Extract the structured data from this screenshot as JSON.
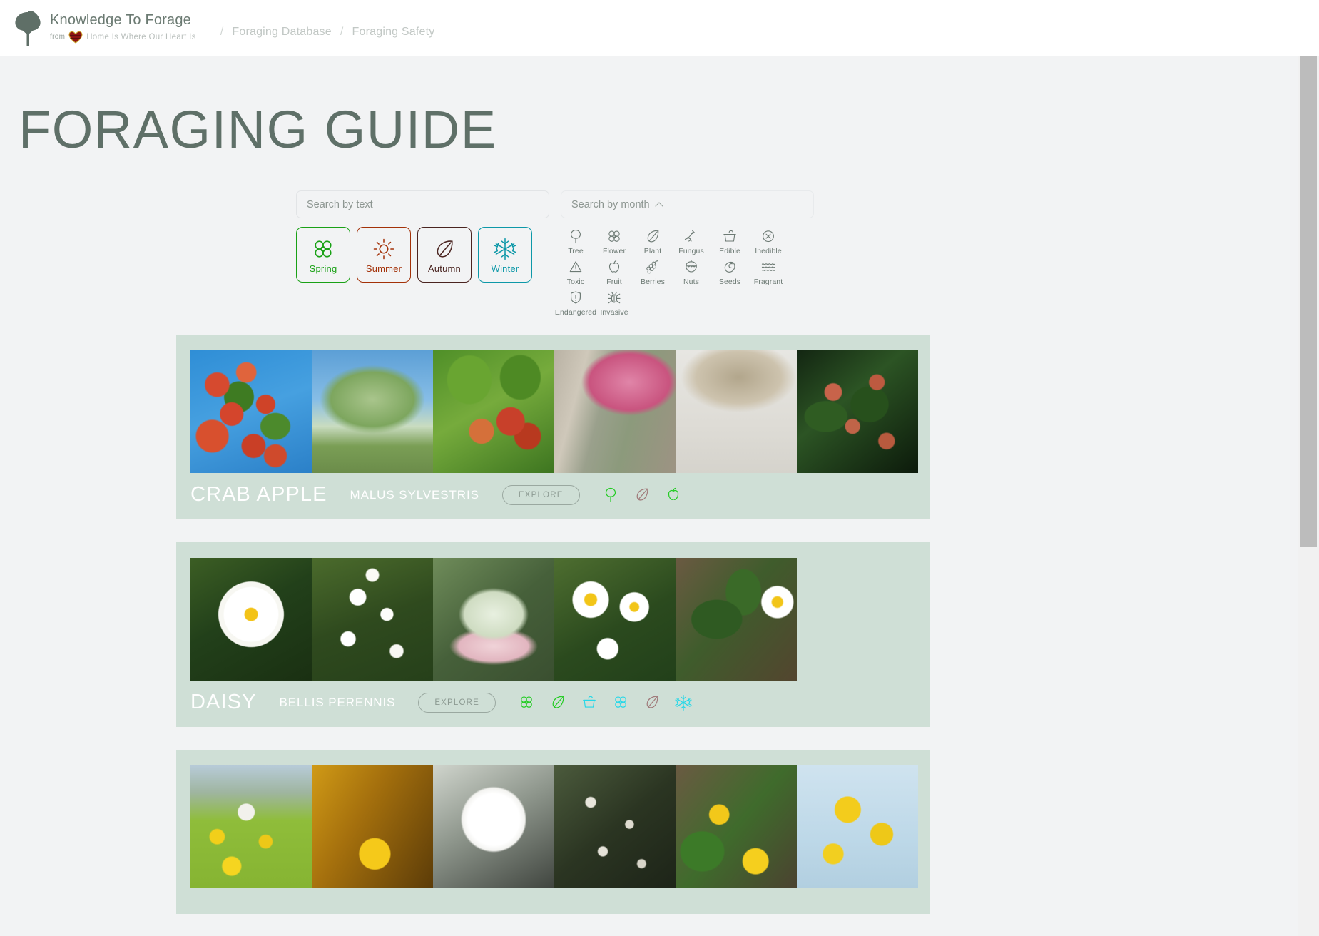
{
  "header": {
    "brand_title": "Knowledge To Forage",
    "brand_from": "from",
    "brand_sub": "Home Is Where Our Heart Is",
    "logo_icon": "tree-icon",
    "heart_icon": "tartan-heart-icon",
    "breadcrumbs": [
      {
        "sep": "/",
        "label": "Foraging Database"
      },
      {
        "sep": "/",
        "label": "Foraging Safety"
      }
    ]
  },
  "page": {
    "title": "FORAGING GUIDE",
    "title_color": "#5f7068",
    "background": "#f2f3f4"
  },
  "search": {
    "text_placeholder": "Search by text",
    "text_value": "",
    "month_label": "Search by month",
    "month_caret": "chevron-up-icon"
  },
  "seasons": [
    {
      "label": "Spring",
      "icon": "flower-icon",
      "color": "#1aa116"
    },
    {
      "label": "Summer",
      "icon": "sun-icon",
      "color": "#a33108"
    },
    {
      "label": "Autumn",
      "icon": "leaf-icon",
      "color": "#4a2420"
    },
    {
      "label": "Winter",
      "icon": "snowflake-icon",
      "color": "#0d98a8"
    }
  ],
  "tags": [
    {
      "label": "Tree",
      "icon": "tree-icon"
    },
    {
      "label": "Flower",
      "icon": "flower-icon"
    },
    {
      "label": "Plant",
      "icon": "leaf-icon"
    },
    {
      "label": "Fungus",
      "icon": "fungus-icon"
    },
    {
      "label": "Edible",
      "icon": "pot-icon"
    },
    {
      "label": "Inedible",
      "icon": "circle-x-icon"
    },
    {
      "label": "Toxic",
      "icon": "warning-triangle-icon"
    },
    {
      "label": "Fruit",
      "icon": "apple-icon"
    },
    {
      "label": "Berries",
      "icon": "berries-icon"
    },
    {
      "label": "Nuts",
      "icon": "acorn-icon"
    },
    {
      "label": "Seeds",
      "icon": "seed-icon"
    },
    {
      "label": "Fragrant",
      "icon": "waves-icon"
    },
    {
      "label": "Endangered",
      "icon": "shield-alert-icon"
    },
    {
      "label": "Invasive",
      "icon": "bug-icon"
    }
  ],
  "tag_colors": {
    "ink": "#6d7a74"
  },
  "card_colors": {
    "background": "#cfdfd6",
    "green": "#22cc22",
    "cyan": "#25d8e8",
    "brown": "#a07a7a"
  },
  "explore_label": "EXPLORE",
  "cards": [
    {
      "common_name": "CRAB APPLE",
      "latin_name": "MALUS SYLVESTRIS",
      "icons": [
        {
          "name": "tree-icon",
          "color": "#22cc22"
        },
        {
          "name": "leaf-icon",
          "color": "#a07a7a"
        },
        {
          "name": "apple-icon",
          "color": "#22cc22"
        }
      ],
      "images": [
        "crab-apple-fruit-on-branch-blue-sky",
        "crab-apple-tree-in-meadow",
        "crab-apples-ripening-green-leaves",
        "pink-crab-apple-blossom-along-wall",
        "bare-crab-apple-branches-winter",
        "crab-apple-fruit-dark-foliage"
      ]
    },
    {
      "common_name": "DAISY",
      "latin_name": "BELLIS PERENNIS",
      "icons": [
        {
          "name": "flower-icon",
          "color": "#22cc22"
        },
        {
          "name": "leaf-icon",
          "color": "#22cc22"
        },
        {
          "name": "pot-icon",
          "color": "#25d8e8"
        },
        {
          "name": "flower-icon",
          "color": "#25d8e8"
        },
        {
          "name": "leaf-icon",
          "color": "#a07a7a"
        },
        {
          "name": "snowflake-icon",
          "color": "#25d8e8"
        }
      ],
      "images": [
        "single-oxeye-daisy-white-petals",
        "daisy-cluster-in-grass",
        "daisy-underside-pink-tipped-petals",
        "daisies-among-green-leaves",
        "daisy-rosette-leaves-on-soil"
      ]
    },
    {
      "common_name": "",
      "latin_name": "",
      "icons": [],
      "images": [
        "dandelion-field-yellow-flowers",
        "dandelion-golden-backlight",
        "dandelion-clock-seedhead",
        "dandelion-seeds-floating",
        "dandelion-flowers-leaf-litter",
        "yellow-dandelion-flowers-blue-sky"
      ]
    }
  ],
  "scrollbar": {
    "arrow_icon": "scroll-up-arrow-icon"
  }
}
